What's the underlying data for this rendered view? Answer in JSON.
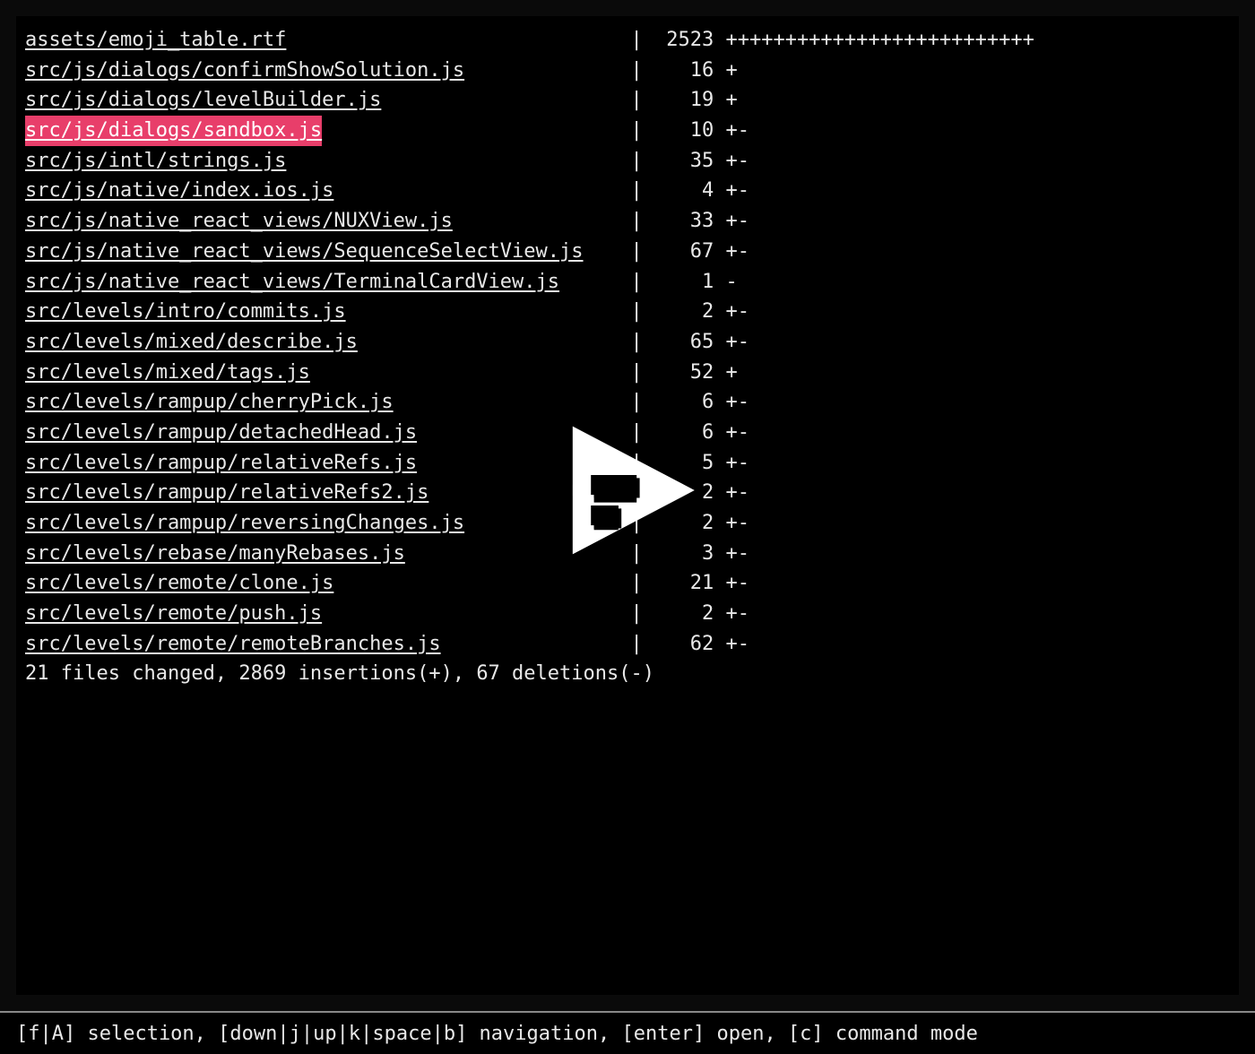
{
  "diff": {
    "name_col_width": 51,
    "rows": [
      {
        "file": "assets/emoji_table.rtf",
        "count": "2523",
        "stat": "++++++++++++++++++++++++++",
        "selected": false
      },
      {
        "file": "src/js/dialogs/confirmShowSolution.js",
        "count": "16",
        "stat": "+",
        "selected": false
      },
      {
        "file": "src/js/dialogs/levelBuilder.js",
        "count": "19",
        "stat": "+",
        "selected": false
      },
      {
        "file": "src/js/dialogs/sandbox.js",
        "count": "10",
        "stat": "+-",
        "selected": true
      },
      {
        "file": "src/js/intl/strings.js",
        "count": "35",
        "stat": "+-",
        "selected": false
      },
      {
        "file": "src/js/native/index.ios.js",
        "count": "4",
        "stat": "+-",
        "selected": false
      },
      {
        "file": "src/js/native_react_views/NUXView.js",
        "count": "33",
        "stat": "+-",
        "selected": false
      },
      {
        "file": "src/js/native_react_views/SequenceSelectView.js",
        "count": "67",
        "stat": "+-",
        "selected": false
      },
      {
        "file": "src/js/native_react_views/TerminalCardView.js",
        "count": "1",
        "stat": "-",
        "selected": false
      },
      {
        "file": "src/levels/intro/commits.js",
        "count": "2",
        "stat": "+-",
        "selected": false
      },
      {
        "file": "src/levels/mixed/describe.js",
        "count": "65",
        "stat": "+-",
        "selected": false
      },
      {
        "file": "src/levels/mixed/tags.js",
        "count": "52",
        "stat": "+",
        "selected": false
      },
      {
        "file": "src/levels/rampup/cherryPick.js",
        "count": "6",
        "stat": "+-",
        "selected": false
      },
      {
        "file": "src/levels/rampup/detachedHead.js",
        "count": "6",
        "stat": "+-",
        "selected": false
      },
      {
        "file": "src/levels/rampup/relativeRefs.js",
        "count": "5",
        "stat": "+-",
        "selected": false
      },
      {
        "file": "src/levels/rampup/relativeRefs2.js",
        "count": "2",
        "stat": "+-",
        "selected": false
      },
      {
        "file": "src/levels/rampup/reversingChanges.js",
        "count": "2",
        "stat": "+-",
        "selected": false
      },
      {
        "file": "src/levels/rebase/manyRebases.js",
        "count": "3",
        "stat": "+-",
        "selected": false
      },
      {
        "file": "src/levels/remote/clone.js",
        "count": "21",
        "stat": "+-",
        "selected": false
      },
      {
        "file": "src/levels/remote/push.js",
        "count": "2",
        "stat": "+-",
        "selected": false
      },
      {
        "file": "src/levels/remote/remoteBranches.js",
        "count": "62",
        "stat": "+-",
        "selected": false
      }
    ],
    "summary": "21 files changed, 2869 insertions(+), 67 deletions(-)"
  },
  "statusBar": {
    "text": "[f|A] selection, [down|j|up|k|space|b] navigation, [enter] open, [c] command mode"
  }
}
